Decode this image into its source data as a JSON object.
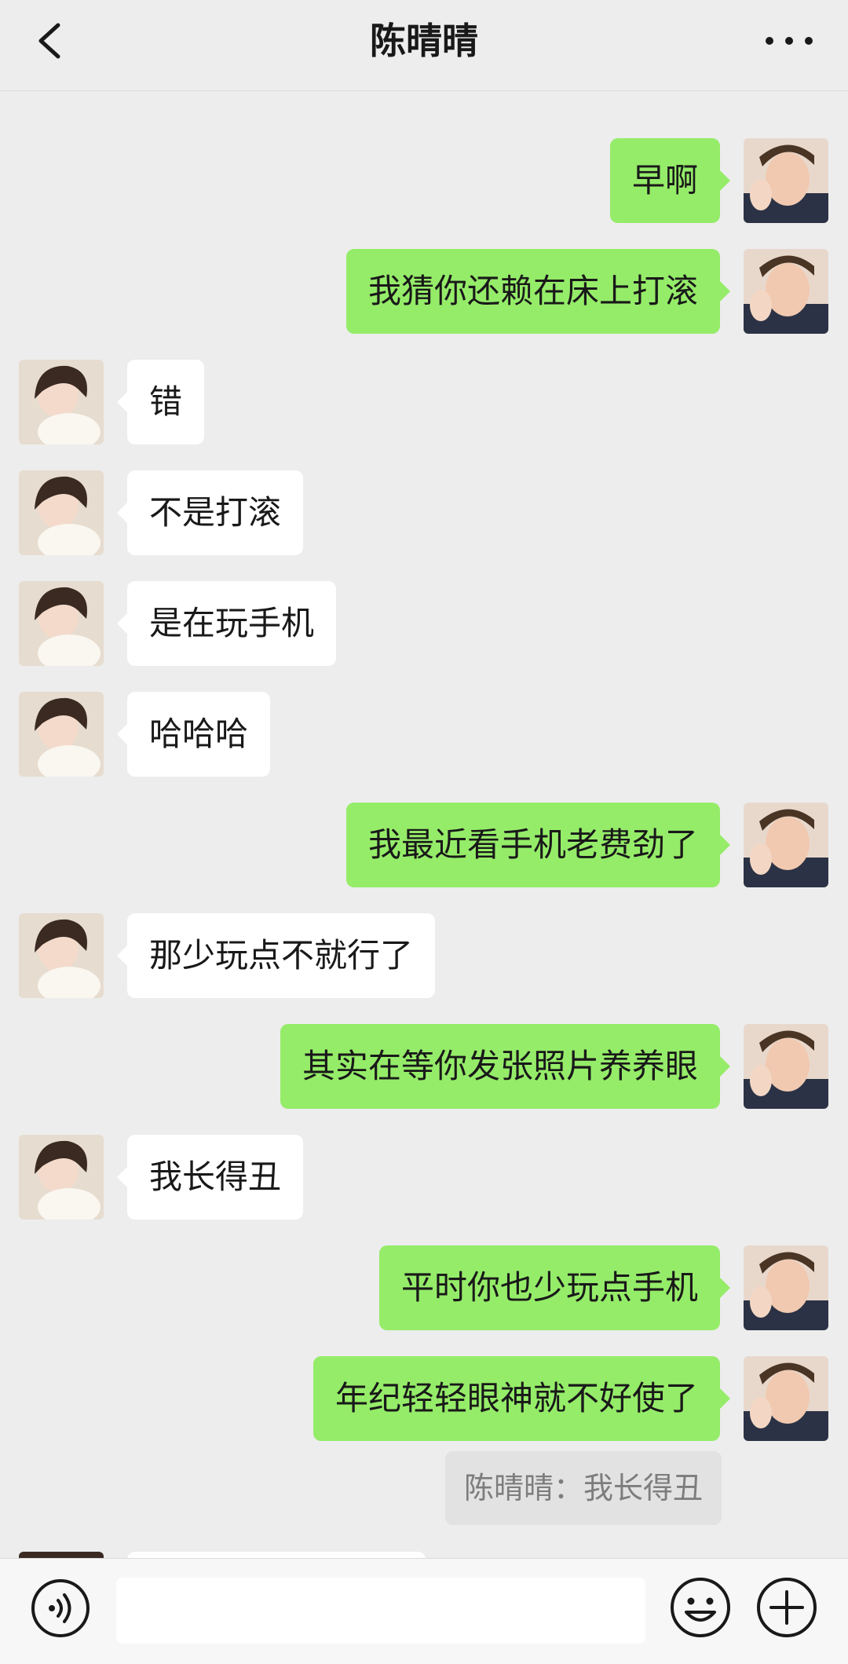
{
  "header": {
    "title": "陈晴晴",
    "back_icon": "chevron-left-icon",
    "more_icon": "more-dots-icon"
  },
  "messages": [
    {
      "from": "me",
      "text": "早啊"
    },
    {
      "from": "me",
      "text": "我猜你还赖在床上打滚"
    },
    {
      "from": "her",
      "text": "错"
    },
    {
      "from": "her",
      "text": "不是打滚"
    },
    {
      "from": "her",
      "text": "是在玩手机"
    },
    {
      "from": "her",
      "text": "哈哈哈"
    },
    {
      "from": "me",
      "text": "我最近看手机老费劲了"
    },
    {
      "from": "her",
      "text": "那少玩点不就行了"
    },
    {
      "from": "me",
      "text": "其实在等你发张照片养养眼"
    },
    {
      "from": "her",
      "text": "我长得丑"
    },
    {
      "from": "me",
      "text": "平时你也少玩点手机"
    },
    {
      "from": "me",
      "text": "年纪轻轻眼神就不好使了"
    }
  ],
  "quote": {
    "text": "陈晴晴：我长得丑"
  },
  "input_bar": {
    "voice_icon": "voice-icon",
    "emoji_icon": "emoji-icon",
    "plus_icon": "plus-icon",
    "input_value": ""
  },
  "colors": {
    "background": "#ededed",
    "my_bubble": "#95ec69",
    "her_bubble": "#ffffff",
    "quote_bg": "#e2e2e2"
  }
}
